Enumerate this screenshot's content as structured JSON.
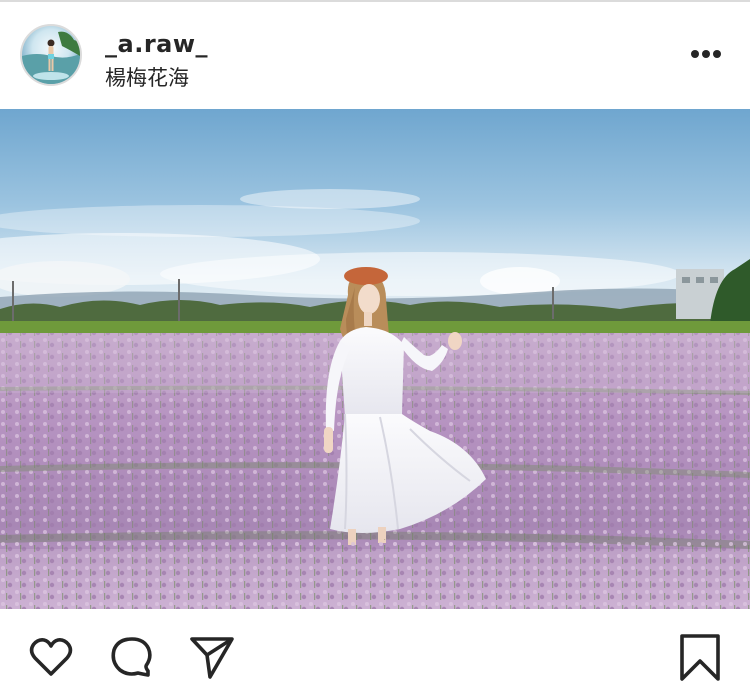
{
  "post": {
    "username": "_a.raw_",
    "location": "楊梅花海"
  },
  "icons": {
    "avatar": "profile-avatar",
    "more": "more-horizontal-icon",
    "like": "heart-outline-icon",
    "comment": "comment-bubble-icon",
    "share": "paper-plane-icon",
    "save": "bookmark-outline-icon"
  },
  "colors": {
    "text": "#262626",
    "divider": "#dbdbdb",
    "sky": "#7fb2d6",
    "lavender": "#b79ac3"
  }
}
